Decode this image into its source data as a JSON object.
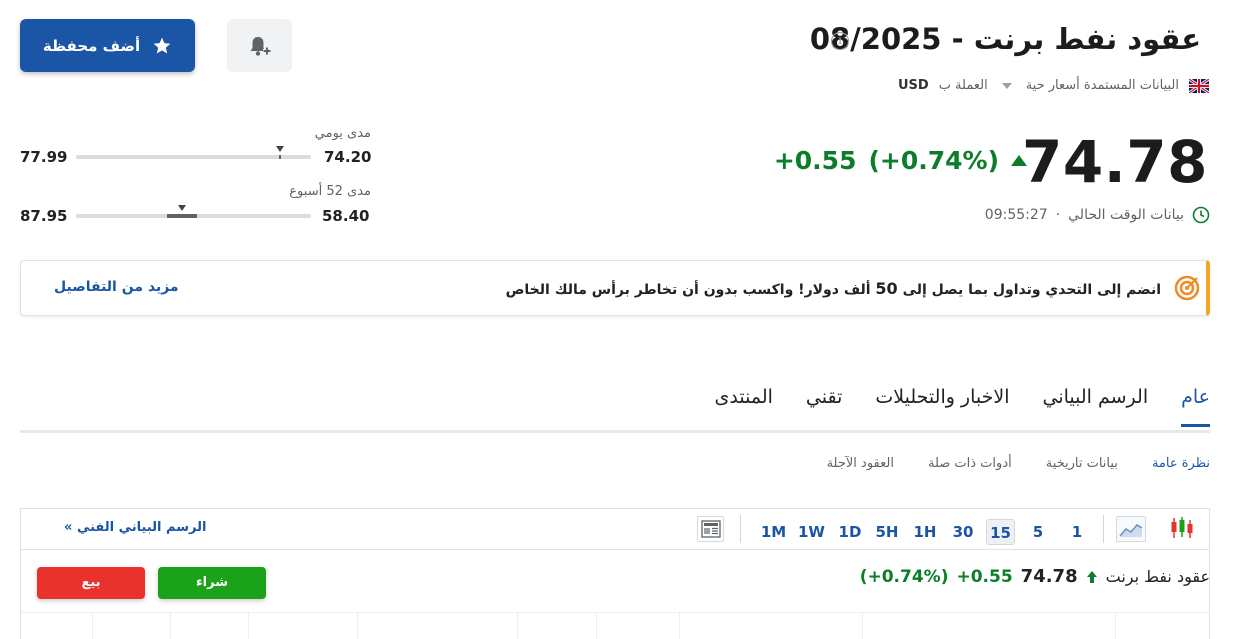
{
  "header": {
    "title": "عقود نفط برنت - 08/2025",
    "info_glyph": "i",
    "data_source": "البيانات المستمدة أسعار حية",
    "currency_label": "العملة ب",
    "currency": "USD",
    "add_portfolio_label": "أضف محفظة"
  },
  "quote": {
    "price": "74.78",
    "change": "+0.55",
    "change_pct": "(+0.74%)",
    "time_label": "بيانات الوقت الحالي",
    "time": "09:55:27"
  },
  "ranges": {
    "daily": {
      "label": "مدى يومي",
      "low": "74.20",
      "high": "77.99",
      "position_fraction": 0.13
    },
    "week52": {
      "label": "مدى 52 أسبوع",
      "low": "58.40",
      "high": "87.95",
      "position_fraction": 0.55
    }
  },
  "banner": {
    "text_before": "انضم إلى التحدي وتداول بما يصل إلى",
    "amount": "50",
    "text_after": "ألف دولار! واكسب بدون أن تخاطر برأس مالك الخاص",
    "link": "مزيد من التفاصيل",
    "accent_color": "#f5a623"
  },
  "tabs": [
    {
      "label": "عام",
      "active": true
    },
    {
      "label": "الرسم البياني"
    },
    {
      "label": "الاخبار والتحليلات"
    },
    {
      "label": "تقني"
    },
    {
      "label": "المنتدى"
    }
  ],
  "subtabs": [
    {
      "label": "نظرة عامة",
      "active": true
    },
    {
      "label": "بيانات تاريخية"
    },
    {
      "label": "أدوات ذات صلة"
    },
    {
      "label": "العقود الآجلة"
    }
  ],
  "chart_toolbar": {
    "timeframes": [
      "1",
      "5",
      "15",
      "30",
      "1H",
      "5H",
      "1D",
      "1W",
      "1M"
    ],
    "selected": "15",
    "technical_link": "الرسم البياني الفني",
    "technical_arrow": "»"
  },
  "chart_header": {
    "name": "عقود نفط برنت",
    "price": "74.78",
    "change": "+0.55",
    "change_pct": "(+0.74%)",
    "buy_label": "شراء",
    "sell_label": "بيع"
  },
  "colors": {
    "accent": "#1b56a6",
    "positive": "#0c7d2b",
    "buy": "#1aa31a",
    "sell": "#e8322b"
  },
  "icons": {
    "star": "star-icon",
    "bell": "bell-plus-icon",
    "clock": "clock-icon",
    "target": "target-icon",
    "candles": "candlestick-icon",
    "area": "area-chart-icon",
    "news": "news-icon"
  }
}
